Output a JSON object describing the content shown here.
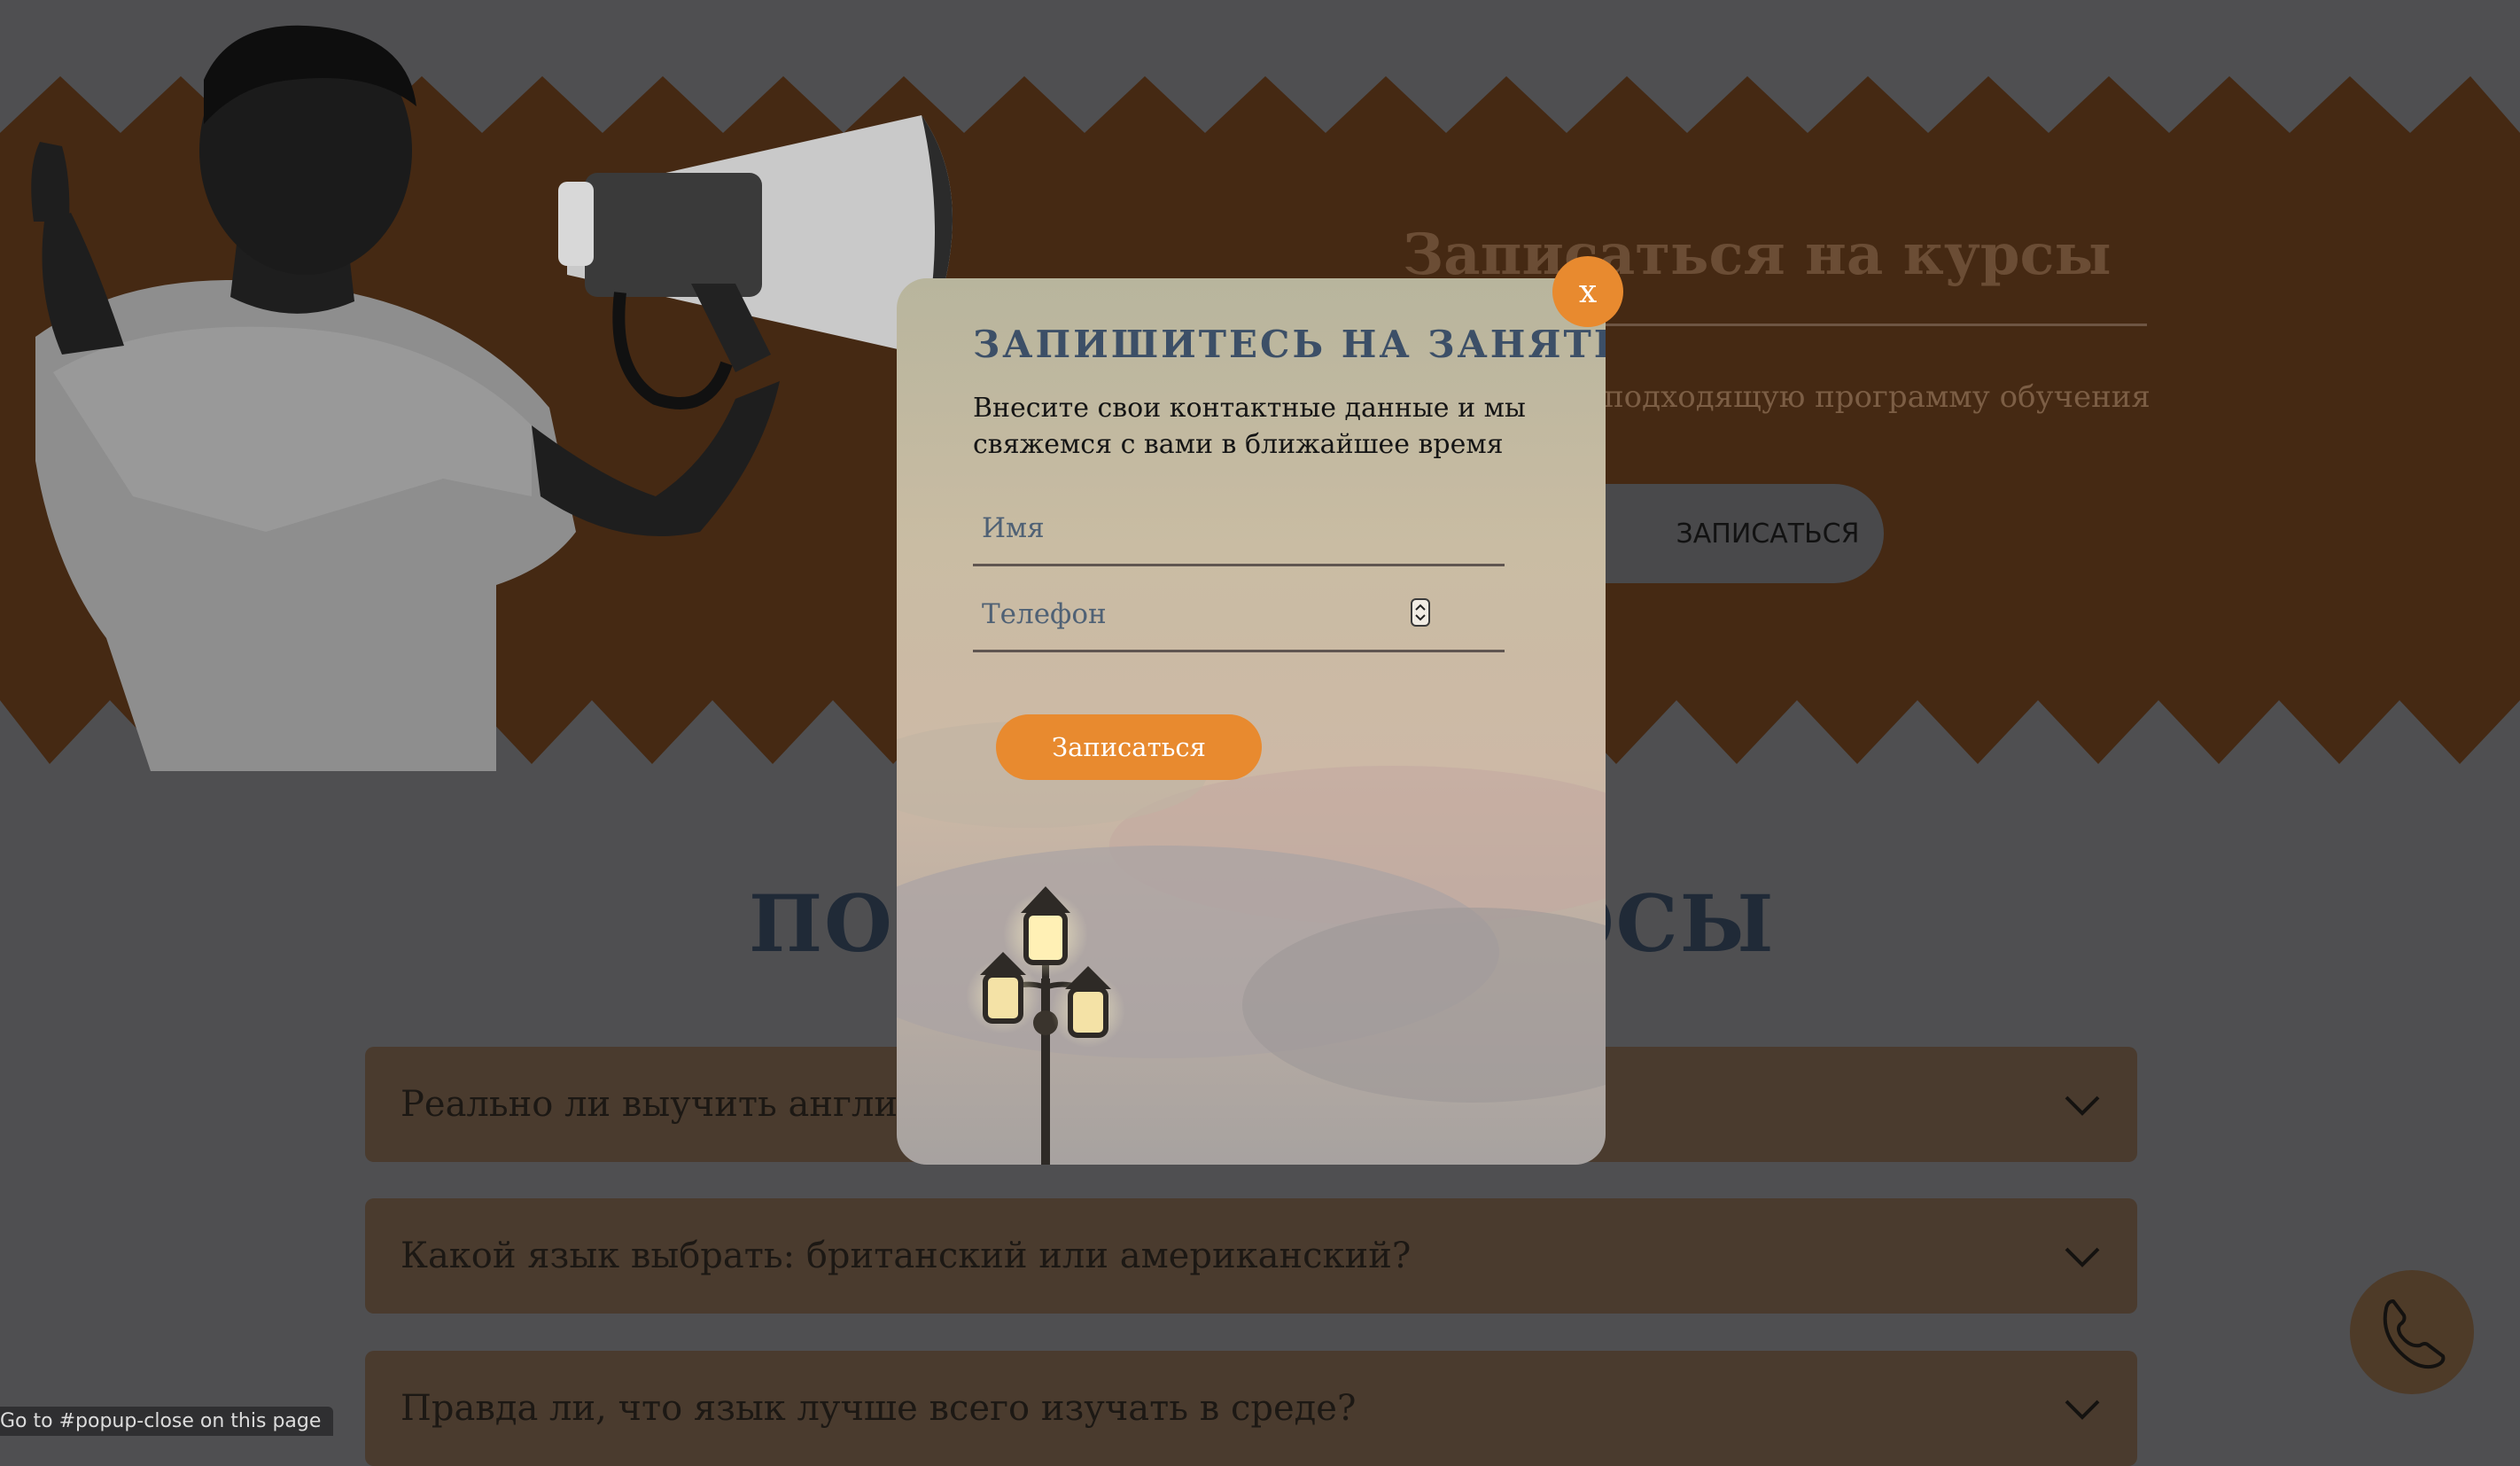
{
  "hero": {
    "title": "Записаться на курсы",
    "subtitle": "подходящую программу обучения",
    "button_label": "ЗАПИСАТЬСЯ",
    "band_color": "#452913"
  },
  "faq": {
    "title_left": "ПОП",
    "title_right": "ОСЫ",
    "items": [
      {
        "question": "Реально ли выучить англи"
      },
      {
        "question": "Какой язык выбрать: британский или американский?"
      },
      {
        "question": "Правда ли, что язык лучше всего изучать в среде?"
      }
    ]
  },
  "popup": {
    "title": "ЗАПИШИТЕСЬ НА ЗАНЯТИЯ",
    "description": "Внесите свои контактные данные и мы свяжемся с вами в ближайшее время",
    "name_placeholder": "Имя",
    "phone_placeholder": "Телефон",
    "submit_label": "Записаться",
    "close_label": "x"
  },
  "status_bar": {
    "link_hint": "Go to #popup-close on this page"
  },
  "colors": {
    "accent": "#e88a2f",
    "overlay": "#4f4f51",
    "popup_title": "#3c4f67"
  },
  "icons": {
    "phone": "phone-icon",
    "chevron": "chevron-down-icon",
    "close": "close-icon"
  }
}
